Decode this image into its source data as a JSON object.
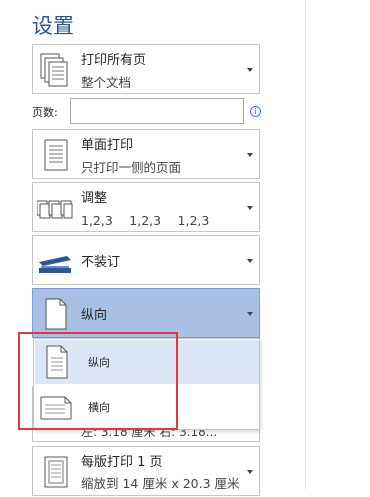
{
  "title": "设置",
  "settings": [
    {
      "line1": "打印所有页",
      "line2": "整个文档",
      "icon": "pages-icon"
    },
    {
      "line1": "单面打印",
      "line2": "只打印一侧的页面",
      "icon": "single-sided-icon"
    },
    {
      "line1": "调整",
      "line2": "1,2,3　 1,2,3　 1,2,3",
      "icon": "collate-icon"
    },
    {
      "line1": "不装订",
      "icon": "stapler-icon"
    },
    {
      "line1": "纵向",
      "icon": "portrait-icon"
    }
  ],
  "pages_field": {
    "label": "页数:",
    "value": ""
  },
  "info_symbol": "i",
  "dropdown": {
    "items": [
      {
        "label": "纵向",
        "icon": "portrait-icon",
        "highlighted": true
      },
      {
        "label": "横向",
        "icon": "landscape-icon",
        "highlighted": false
      }
    ]
  },
  "margins_partial": "左: 3.18 厘米   右: 3.18...",
  "per_sheet": {
    "line1": "每版打印 1 页",
    "line2": "缩放到 14 厘米 x 20.3 厘米"
  },
  "colors": {
    "accent": "#2b579a",
    "selected": "#a9c0e5",
    "highlight": "#dce6f5",
    "annotation": "#e53935"
  }
}
